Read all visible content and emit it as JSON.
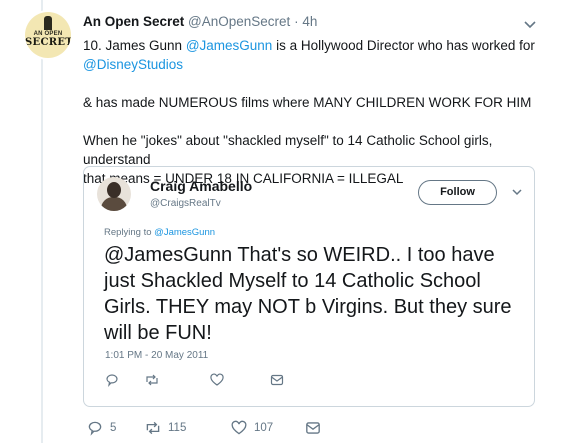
{
  "tweet": {
    "avatar_text_top": "AN OPEN",
    "avatar_text_bottom": "SECRET",
    "author_name": "An Open Secret",
    "author_handle": "@AnOpenSecret",
    "separator": "·",
    "time": "4h",
    "line1_prefix": "10. James Gunn ",
    "line1_mention": "@JamesGunn",
    "line1_suffix": " is a Hollywood Director who has worked for",
    "line2_mention": "@DisneyStudios",
    "paragraph2": "& has made NUMEROUS films where MANY CHILDREN WORK FOR HIM",
    "paragraph3_line1": "When he \"jokes\" about \"shackled myself\" to 14 Catholic School girls, understand",
    "paragraph3_line2": "that means = UNDER 18 IN CALIFORNIA = ILLEGAL"
  },
  "quoted": {
    "name": "Craig Amabello",
    "handle": "@CraigsRealTv",
    "follow_label": "Follow",
    "replying_prefix": "Replying to ",
    "replying_mention": "@JamesGunn",
    "text": "@JamesGunn That's so WEIRD.. I too have just Shackled Myself to 14 Catholic School Girls. THEY may NOT b Virgins. But they sure will be FUN!",
    "timestamp": "1:01 PM - 20 May 2011"
  },
  "actions": {
    "reply_count": "5",
    "retweet_count": "115",
    "like_count": "107"
  },
  "colors": {
    "link": "#1b95e0",
    "muted": "#657786",
    "border": "#ccd6dd",
    "text": "#14171a"
  }
}
